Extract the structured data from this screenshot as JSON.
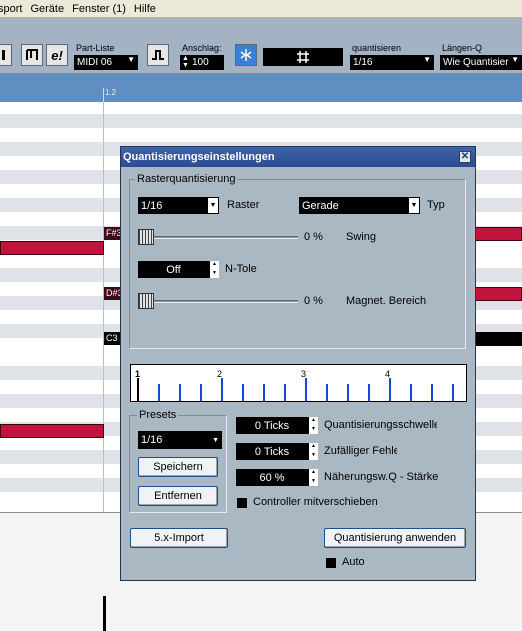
{
  "menubar": {
    "items": [
      "sport",
      "Geräte",
      "Fenster (1)",
      "Hilfe"
    ]
  },
  "toolbar": {
    "part_list_label": "Part-Liste",
    "part_list_value": "MIDI 06",
    "anschlag_label": "Anschlag:",
    "anschlag_value": "100",
    "quantize_label": "quantisieren",
    "quantize_value": "1/16",
    "length_label": "Längen-Q",
    "length_value": "Wie Quantisier",
    "icons": [
      "pencil-icon",
      "bracket-icon",
      "e-icon",
      "step-icon",
      "snap-icon",
      "grid-icon"
    ]
  },
  "ruler": {
    "bar_label": "1.2"
  },
  "notes": [
    {
      "label": "F#3"
    },
    {
      "label": "D#3"
    },
    {
      "label": "C3"
    }
  ],
  "dialog": {
    "title": "Quantisierungseinstellungen",
    "raster_group_label": "Rasterquantisierung",
    "raster_value": "1/16",
    "raster_label": "Raster",
    "type_value": "Gerade",
    "type_label": "Typ",
    "swing_percent": "0 %",
    "swing_label": "Swing",
    "ntole_value": "Off",
    "ntole_label": "N-Tole",
    "magnet_percent": "0 %",
    "magnet_label": "Magnet. Bereich",
    "grid_beats": [
      "1",
      "2",
      "3",
      "4"
    ],
    "presets_group_label": "Presets",
    "preset_value": "1/16",
    "save_button": "Speichern",
    "remove_button": "Entfernen",
    "threshold_value": "0 Ticks",
    "threshold_label": "Quantisierungsschwelle",
    "random_value": "0 Ticks",
    "random_label": "Zufälliger Fehler",
    "strength_value": "60 %",
    "strength_label": "Näherungsw.Q - Stärke",
    "controller_label": "Controller mitverschieben",
    "import_button": "5.x-Import",
    "apply_button": "Quantisierung anwenden",
    "auto_label": "Auto"
  }
}
